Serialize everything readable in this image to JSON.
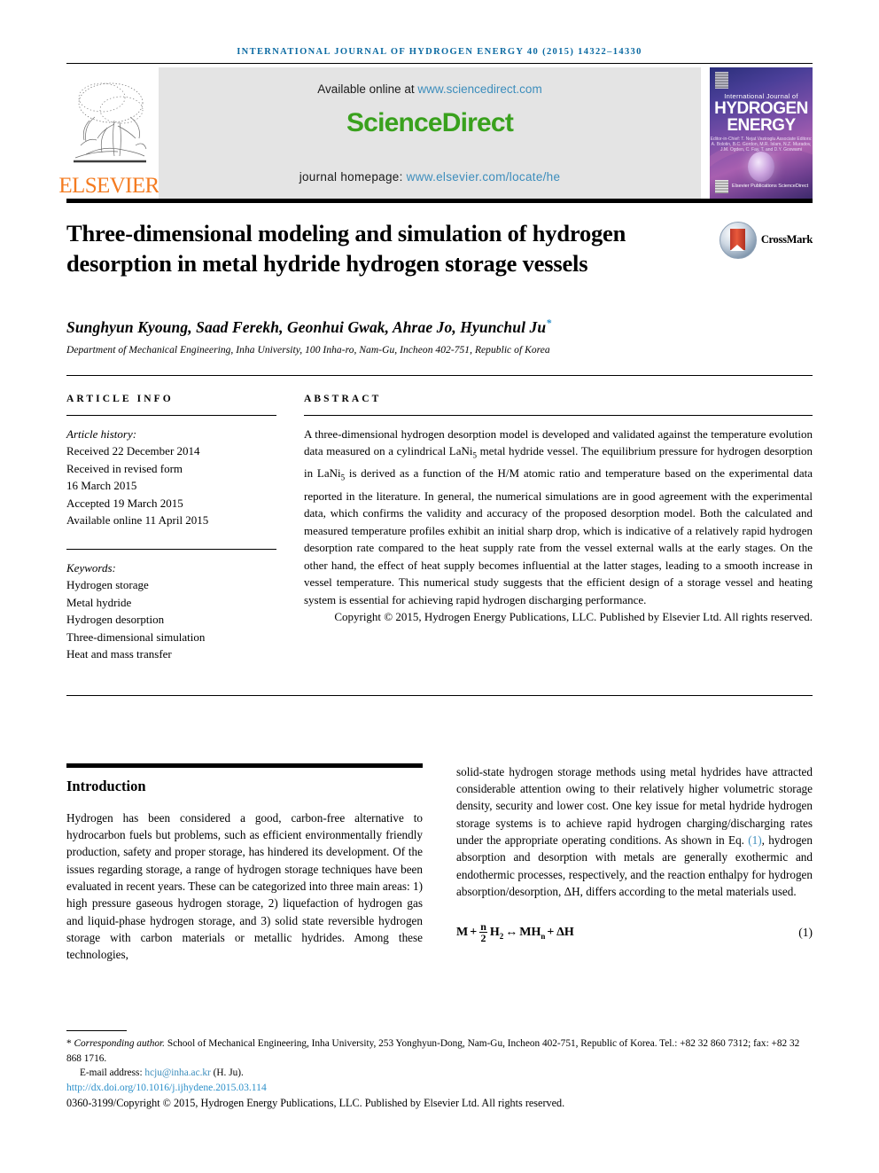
{
  "running_head": "INTERNATIONAL JOURNAL OF HYDROGEN ENERGY 40 (2015) 14322–14330",
  "masthead": {
    "publisher_name": "ELSEVIER",
    "available_prefix": "Available online at ",
    "available_url": "www.sciencedirect.com",
    "sciencedirect_word": "ScienceDirect",
    "homepage_prefix": "journal homepage: ",
    "homepage_url": "www.elsevier.com/locate/he",
    "cover": {
      "sub": "International Journal of",
      "line1": "HYDROGEN",
      "line2": "ENERGY",
      "editors": "Editor-in-Chief: T. Nejat Veziroglu\nAssociate Editors: A. Bolotin, B.C. Gordon, M.R. Islam,\nN.Z. Muradov, J.M. Ogden,\nC. Fay, T. and D.Y. Goswami",
      "footer_note": "Elsevier Publications\nScienceDirect"
    }
  },
  "article": {
    "title": "Three-dimensional modeling and simulation of hydrogen desorption in metal hydride hydrogen storage vessels",
    "crossmark_label": "CrossMark",
    "authors": "Sunghyun Kyoung, Saad Ferekh, Geonhui Gwak, Ahrae Jo, Hyunchul Ju",
    "corresponding_marker": "*",
    "affiliation": "Department of Mechanical Engineering, Inha University, 100 Inha-ro, Nam-Gu, Incheon 402-751, Republic of Korea"
  },
  "article_info": {
    "heading": "ARTICLE INFO",
    "history_label": "Article history:",
    "history": [
      "Received 22 December 2014",
      "Received in revised form",
      "16 March 2015",
      "Accepted 19 March 2015",
      "Available online 11 April 2015"
    ],
    "keywords_label": "Keywords:",
    "keywords": [
      "Hydrogen storage",
      "Metal hydride",
      "Hydrogen desorption",
      "Three-dimensional simulation",
      "Heat and mass transfer"
    ]
  },
  "abstract": {
    "heading": "ABSTRACT",
    "body_part1": "A three-dimensional hydrogen desorption model is developed and validated against the temperature evolution data measured on a cylindrical LaNi",
    "sub1": "5",
    "body_part2": " metal hydride vessel. The equilibrium pressure for hydrogen desorption in LaNi",
    "sub2": "5",
    "body_part3": " is derived as a function of the H/M atomic ratio and temperature based on the experimental data reported in the literature. In general, the numerical simulations are in good agreement with the experimental data, which confirms the validity and accuracy of the proposed desorption model. Both the calculated and measured temperature profiles exhibit an initial sharp drop, which is indicative of a relatively rapid hydrogen desorption rate compared to the heat supply rate from the vessel external walls at the early stages. On the other hand, the effect of heat supply becomes influential at the latter stages, leading to a smooth increase in vessel temperature. This numerical study suggests that the efficient design of a storage vessel and heating system is essential for achieving rapid hydrogen discharging performance.",
    "copyright": "Copyright © 2015, Hydrogen Energy Publications, LLC. Published by Elsevier Ltd. All rights reserved."
  },
  "introduction": {
    "heading": "Introduction",
    "left_paragraph": "Hydrogen has been considered a good, carbon-free alternative to hydrocarbon fuels but problems, such as efficient environmentally friendly production, safety and proper storage, has hindered its development. Of the issues regarding storage, a range of hydrogen storage techniques have been evaluated in recent years. These can be categorized into three main areas: 1) high pressure gaseous hydrogen storage, 2) liquefaction of hydrogen gas and liquid-phase hydrogen storage, and 3) solid state reversible hydrogen storage with carbon materials or metallic hydrides. Among these technologies,",
    "right_paragraph_a": "solid-state hydrogen storage methods using metal hydrides have attracted considerable attention owing to their relatively higher volumetric storage density, security and lower cost. One key issue for metal hydride hydrogen storage systems is to achieve rapid hydrogen charging/discharging rates under the appropriate operating conditions. As shown in Eq. ",
    "eq_ref": "(1)",
    "right_paragraph_b": ", hydrogen absorption and desorption with metals are generally exothermic and endothermic processes, respectively, and the reaction enthalpy for hydrogen absorption/desorption, ΔH, differs according to the metal materials used.",
    "equation": {
      "lhs": "M",
      "plus": "+",
      "num": "n",
      "den": "2",
      "h2": "H",
      "h2sub": "2",
      "arrow": "↔",
      "rhs": "MH",
      "rhssub": "n",
      "tail": "+ ΔH",
      "number": "(1)"
    }
  },
  "footnote": {
    "marker": "*",
    "corresponding_italic": "Corresponding author.",
    "corresponding_rest": " School of Mechanical Engineering, Inha University, 253 Yonghyun-Dong, Nam-Gu, Incheon 402-751, Republic of Korea. Tel.: +82 32 860 7312; fax: +82 32 868 1716.",
    "email_label": "E-mail address: ",
    "email": "hcju@inha.ac.kr",
    "email_suffix": " (H. Ju).",
    "doi": "http://dx.doi.org/10.1016/j.ijhydene.2015.03.114",
    "issn_copyright": "0360-3199/Copyright © 2015, Hydrogen Energy Publications, LLC. Published by Elsevier Ltd. All rights reserved."
  },
  "colors": {
    "running_head": "#0b6aa2",
    "link": "#3c8dbc",
    "sciencedirect_green": "#39a11d",
    "elsevier_orange": "#f47b20",
    "doi_blue": "#2b8fc9"
  }
}
